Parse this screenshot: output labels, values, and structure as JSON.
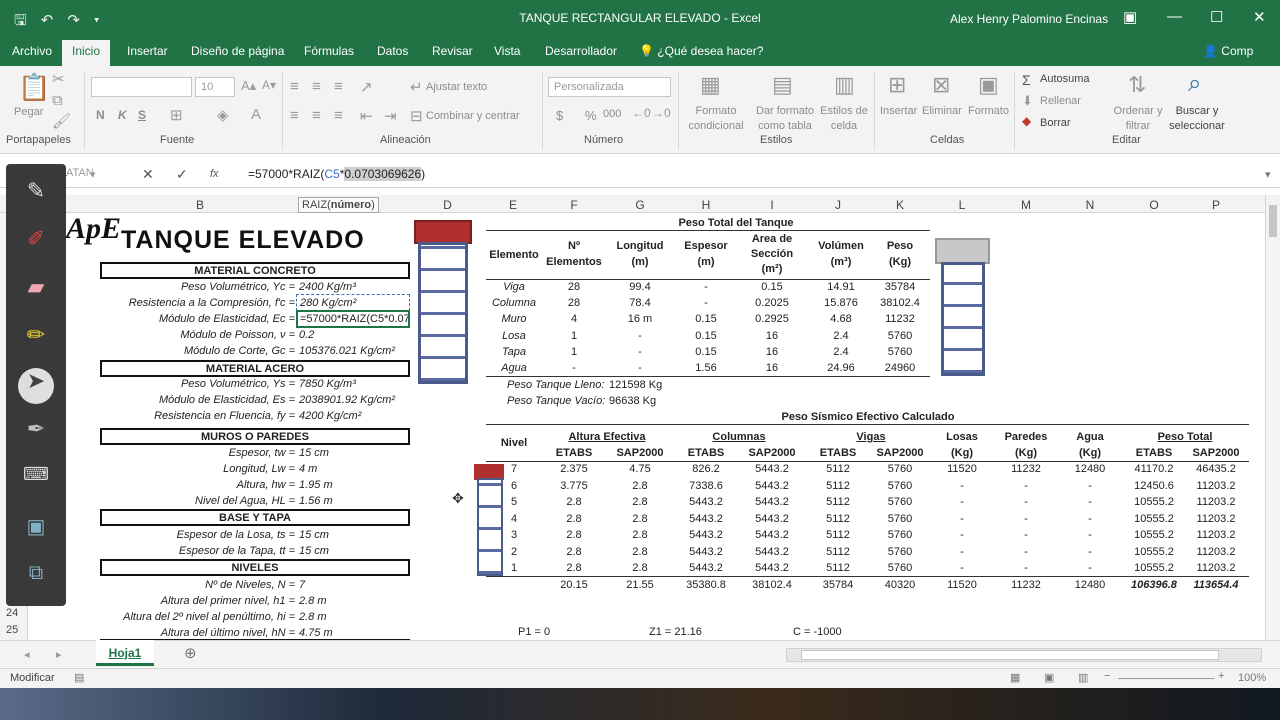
{
  "window": {
    "title": "TANQUE RECTANGULAR ELEVADO  -  Excel",
    "user": "Alex Henry Palomino Encinas"
  },
  "tabs": [
    "Archivo",
    "Inicio",
    "Insertar",
    "Diseño de página",
    "Fórmulas",
    "Datos",
    "Revisar",
    "Vista",
    "Desarrollador",
    "¿Qué desea hacer?",
    "Comp"
  ],
  "ribbon": {
    "clipboard": {
      "paste": "Pegar",
      "group": "Portapapeles"
    },
    "font": {
      "size": "10",
      "bold": "N",
      "italic": "K",
      "underline": "S",
      "group": "Fuente"
    },
    "alignment": {
      "wrap": "Ajustar texto",
      "merge": "Combinar y centrar",
      "group": "Alineación"
    },
    "number": {
      "format": "Personalizada",
      "currency": "$",
      "percent": "%",
      "thousands": "000",
      "group": "Número"
    },
    "styles": {
      "conditional_1": "Formato",
      "conditional_2": "condicional",
      "table_1": "Dar formato",
      "table_2": "como tabla",
      "cell_1": "Estilos de",
      "cell_2": "celda",
      "group": "Estilos"
    },
    "cells": {
      "insert": "Insertar",
      "delete": "Eliminar",
      "format": "Formato",
      "group": "Celdas"
    },
    "editing": {
      "autosum": "Autosuma",
      "fill": "Rellenar",
      "clear": "Borrar",
      "sort_1": "Ordenar y",
      "sort_2": "filtrar",
      "find_1": "Buscar y",
      "find_2": "seleccionar",
      "group": "Editar"
    }
  },
  "formula_bar": {
    "name_box": "ATAN",
    "fx": "fx",
    "prefix": "=57000*RAIZ(",
    "ref": "C5",
    "mid": "*",
    "highlight": "0.0703069626",
    "suffix": ")",
    "tooltip_fn": "RAIZ(",
    "tooltip_arg": "número",
    "tooltip_end": ")"
  },
  "columns": [
    "B",
    "C",
    "D",
    "E",
    "F",
    "G",
    "H",
    "I",
    "J",
    "K",
    "L",
    "M",
    "N",
    "O",
    "P"
  ],
  "rows": [
    "1",
    "2",
    "3",
    "4",
    "5",
    "6",
    "7",
    "8",
    "9",
    "10",
    "11",
    "12",
    "13",
    "14",
    "15",
    "16",
    "17",
    "18",
    "19",
    "20",
    "21",
    "22",
    "23",
    "24",
    "25"
  ],
  "title": "TANQUE ELEVADO",
  "sections": {
    "concreto": "MATERIAL CONCRETO",
    "acero": "MATERIAL ACERO",
    "muros": "MUROS O PAREDES",
    "base": "BASE Y TAPA",
    "niveles": "NIVELES"
  },
  "params": [
    {
      "label": "Peso Volumétrico, Yc =",
      "value": "2400 Kg/m³"
    },
    {
      "label": "Resistencia a la Compresión, f'c =",
      "value": "280 Kg/cm²"
    },
    {
      "label": "Módulo de Elasticidad, Ec =",
      "value": "=57000*RAIZ(C5*0.07"
    },
    {
      "label": "Módulo de Poisson, ν =",
      "value": "0.2"
    },
    {
      "label": "Módulo de Corte, Gc =",
      "value": "105376.021 Kg/cm²"
    },
    {
      "label": "Peso Volumétrico, Ys =",
      "value": "7850 Kg/m³"
    },
    {
      "label": "Módulo de Elasticidad, Es =",
      "value": "2038901.92 Kg/cm²"
    },
    {
      "label": "Resistencia en Fluencia, fy =",
      "value": "4200 Kg/cm²"
    },
    {
      "label": "Espesor, tw =",
      "value": "15 cm"
    },
    {
      "label": "Longitud, Lw =",
      "value": "4 m"
    },
    {
      "label": "Altura, hw =",
      "value": "1.95 m"
    },
    {
      "label": "Nivel del Agua, HL =",
      "value": "1.56 m"
    },
    {
      "label": "Espesor de la Losa, ts =",
      "value": "15 cm"
    },
    {
      "label": "Espesor de la Tapa, tt =",
      "value": "15 cm"
    },
    {
      "label": "Nº de Niveles, N =",
      "value": "7"
    },
    {
      "label": "Altura del primer nivel, h1 =",
      "value": "2.8 m"
    },
    {
      "label": "Altura del 2º nivel al penúltimo, hi =",
      "value": "2.8 m"
    },
    {
      "label": "Altura del último nivel, hN =",
      "value": "4.75 m"
    }
  ],
  "peso_total": {
    "title": "Peso Total del Tanque",
    "headers": [
      [
        "Elemento"
      ],
      [
        "Nº",
        "Elementos"
      ],
      [
        "Longitud",
        "(m)"
      ],
      [
        "Espesor",
        "(m)"
      ],
      [
        "Area de",
        "Sección",
        "(m²)"
      ],
      [
        "Volúmen",
        "(m³)"
      ],
      [
        "Peso",
        "(Kg)"
      ]
    ],
    "rows": [
      [
        "Viga",
        "28",
        "99.4",
        "-",
        "0.15",
        "14.91",
        "35784"
      ],
      [
        "Columna",
        "28",
        "78.4",
        "-",
        "0.2025",
        "15.876",
        "38102.4"
      ],
      [
        "Muro",
        "4",
        "16 m",
        "0.15",
        "0.2925",
        "4.68",
        "11232"
      ],
      [
        "Losa",
        "1",
        "-",
        "0.15",
        "16",
        "2.4",
        "5760"
      ],
      [
        "Tapa",
        "1",
        "-",
        "0.15",
        "16",
        "2.4",
        "5760"
      ],
      [
        "Agua",
        "-",
        "-",
        "1.56",
        "16",
        "24.96",
        "24960"
      ]
    ],
    "lleno_label": "Peso Tanque Lleno:",
    "lleno": "121598 Kg",
    "vacio_label": "Peso Tanque Vacío:",
    "vacio": "96638 Kg"
  },
  "sismico": {
    "title": "Peso Sísmico Efectivo Calculado",
    "groups": [
      "Nivel",
      "Altura Efectiva",
      "Columnas",
      "Vigas",
      "Losas",
      "Paredes",
      "Agua",
      "Peso Total"
    ],
    "subheaders": [
      "ETABS",
      "SAP2000",
      "ETABS",
      "SAP2000",
      "ETABS",
      "SAP2000",
      "(Kg)",
      "(Kg)",
      "(Kg)",
      "ETABS",
      "SAP2000"
    ],
    "rows": [
      [
        "7",
        "2.375",
        "4.75",
        "826.2",
        "5443.2",
        "5112",
        "5760",
        "11520",
        "11232",
        "12480",
        "41170.2",
        "46435.2"
      ],
      [
        "6",
        "3.775",
        "2.8",
        "7338.6",
        "5443.2",
        "5112",
        "5760",
        "-",
        "-",
        "-",
        "12450.6",
        "11203.2"
      ],
      [
        "5",
        "2.8",
        "2.8",
        "5443.2",
        "5443.2",
        "5112",
        "5760",
        "-",
        "-",
        "-",
        "10555.2",
        "11203.2"
      ],
      [
        "4",
        "2.8",
        "2.8",
        "5443.2",
        "5443.2",
        "5112",
        "5760",
        "-",
        "-",
        "-",
        "10555.2",
        "11203.2"
      ],
      [
        "3",
        "2.8",
        "2.8",
        "5443.2",
        "5443.2",
        "5112",
        "5760",
        "-",
        "-",
        "-",
        "10555.2",
        "11203.2"
      ],
      [
        "2",
        "2.8",
        "2.8",
        "5443.2",
        "5443.2",
        "5112",
        "5760",
        "-",
        "-",
        "-",
        "10555.2",
        "11203.2"
      ],
      [
        "1",
        "2.8",
        "2.8",
        "5443.2",
        "5443.2",
        "5112",
        "5760",
        "-",
        "-",
        "-",
        "10555.2",
        "11203.2"
      ]
    ],
    "totals": [
      "",
      "20.15",
      "21.55",
      "35380.8",
      "38102.4",
      "35784",
      "40320",
      "11520",
      "11232",
      "12480",
      "106396.8",
      "113654.4"
    ]
  },
  "footer": {
    "p1": "P1 = 0",
    "z1": "Z1 = 21.16",
    "c": "C = -1000"
  },
  "sheet_tab": "Hoja1",
  "status": {
    "mode": "Modificar",
    "zoom": "100%"
  }
}
